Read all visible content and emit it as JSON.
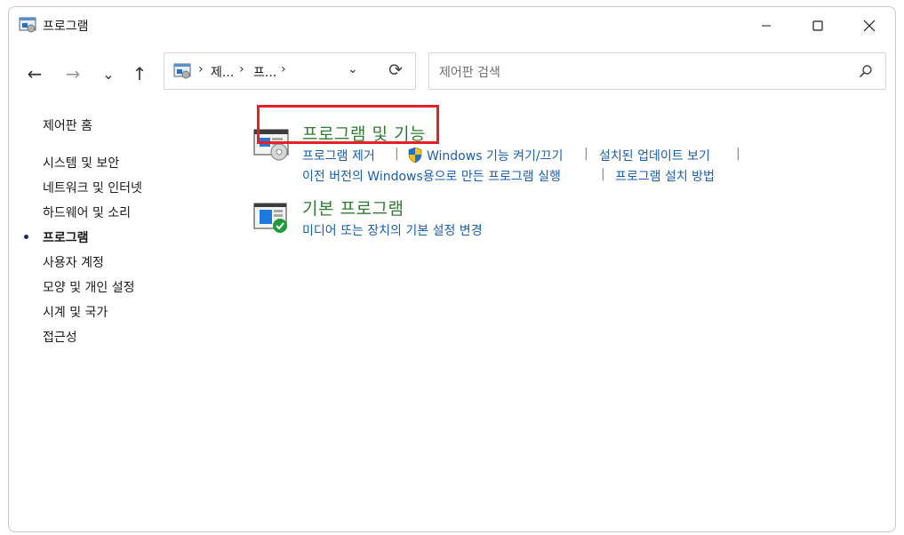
{
  "window": {
    "title": "프로그램"
  },
  "titlebar": {
    "minimize_icon": "minimize-icon",
    "maximize_icon": "maximize-icon",
    "close_icon": "close-icon"
  },
  "nav": {
    "back": "←",
    "forward": "→",
    "recent": "⌄",
    "up": "↑",
    "refresh": "⟳"
  },
  "address": {
    "crumbs": [
      "제...",
      "프..."
    ],
    "separator": "›",
    "dropdown": "⌄"
  },
  "search": {
    "placeholder": "제어판 검색"
  },
  "sidebar": {
    "home": "제어판 홈",
    "items": [
      {
        "label": "시스템 및 보안"
      },
      {
        "label": "네트워크 및 인터넷"
      },
      {
        "label": "하드웨어 및 소리"
      },
      {
        "label": "프로그램",
        "active": true
      },
      {
        "label": "사용자 계정"
      },
      {
        "label": "모양 및 개인 설정"
      },
      {
        "label": "시계 및 국가"
      },
      {
        "label": "접근성"
      }
    ]
  },
  "main": {
    "categories": [
      {
        "title": "프로그램 및 기능",
        "links": [
          "프로그램 제거",
          "Windows 기능 켜기/끄기",
          "설치된 업데이트 보기",
          "이전 버전의 Windows용으로 만든 프로그램 실행",
          "프로그램 설치 방법"
        ]
      },
      {
        "title": "기본 프로그램",
        "links": [
          "미디어 또는 장치의 기본 설정 변경"
        ]
      }
    ],
    "separator": "|"
  },
  "colors": {
    "category_title": "#2e7d32",
    "link": "#1b5fa8",
    "highlight": "#e52026"
  }
}
